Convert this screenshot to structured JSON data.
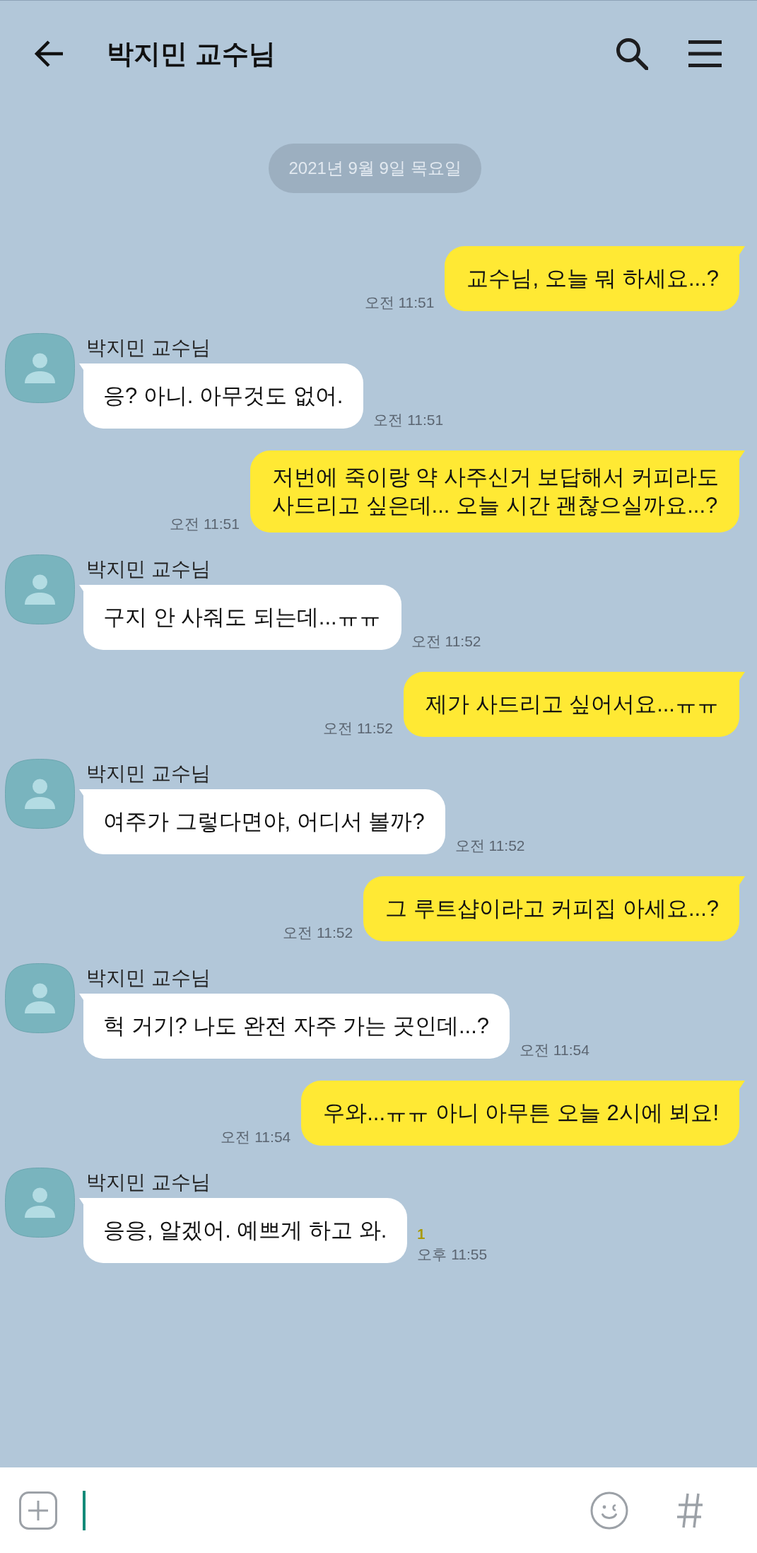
{
  "header": {
    "title": "박지민 교수님"
  },
  "date_divider": "2021년 9월 9일 목요일",
  "messages": [
    {
      "kind": "sent",
      "text": "교수님, 오늘 뭐 하세요...?",
      "time": "오전 11:51"
    },
    {
      "kind": "received",
      "sender": "박지민 교수님",
      "text": "응? 아니. 아무것도 없어.",
      "time": "오전 11:51"
    },
    {
      "kind": "sent",
      "text": "저번에 죽이랑 약 사주신거 보답해서 커피라도\n사드리고 싶은데... 오늘 시간 괜찮으실까요...?",
      "time": "오전 11:51"
    },
    {
      "kind": "received",
      "sender": "박지민 교수님",
      "text": "구지 안 사줘도 되는데...ㅠㅠ",
      "time": "오전 11:52"
    },
    {
      "kind": "sent",
      "text": "제가 사드리고 싶어서요...ㅠㅠ",
      "time": "오전 11:52"
    },
    {
      "kind": "received",
      "sender": "박지민 교수님",
      "text": "여주가 그렇다면야, 어디서 볼까?",
      "time": "오전 11:52"
    },
    {
      "kind": "sent",
      "text": "그 루트샵이라고 커피집 아세요...?",
      "time": "오전 11:52"
    },
    {
      "kind": "received",
      "sender": "박지민 교수님",
      "text": "헉 거기? 나도 완전 자주 가는 곳인데...?",
      "time": "오전 11:54"
    },
    {
      "kind": "sent",
      "text": "우와...ㅠㅠ 아니 아무튼 오늘 2시에 뵈요!",
      "time": "오전 11:54"
    },
    {
      "kind": "received",
      "sender": "박지민 교수님",
      "text": "응응, 알겠어. 예쁘게 하고 와.",
      "time": "오후 11:55",
      "unread": "1"
    }
  ],
  "composer": {
    "focused": true
  }
}
